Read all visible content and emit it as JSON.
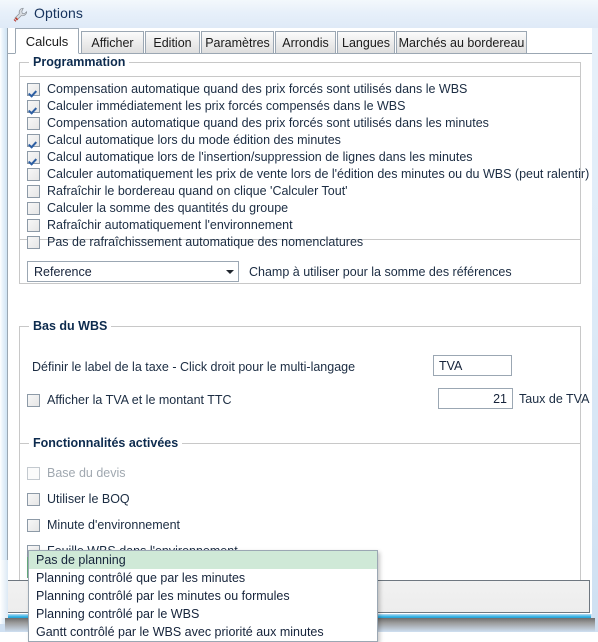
{
  "window": {
    "title": "Options",
    "icon": "wrench-icon"
  },
  "tabs": [
    {
      "label": "Calculs",
      "selected": true
    },
    {
      "label": "Afficher",
      "selected": false
    },
    {
      "label": "Edition",
      "selected": false
    },
    {
      "label": "Paramètres",
      "selected": false
    },
    {
      "label": "Arrondis",
      "selected": false
    },
    {
      "label": "Langues",
      "selected": false
    },
    {
      "label": "Marchés au bordereau",
      "selected": false
    }
  ],
  "groups": {
    "programmation": {
      "title": "Programmation",
      "checkboxes": [
        {
          "label": "Compensation automatique quand des prix forcés sont utilisés dans le WBS",
          "checked": true,
          "disabled": false
        },
        {
          "label": "Calculer immédiatement les prix forcés compensés dans le WBS",
          "checked": true,
          "disabled": false
        },
        {
          "label": "Compensation automatique quand des prix forcés sont utilisés dans les minutes",
          "checked": false,
          "disabled": false
        },
        {
          "label": "Calcul automatique lors du mode édition des minutes",
          "checked": true,
          "disabled": false
        },
        {
          "label": "Calcul automatique lors de l'insertion/suppression de lignes dans les minutes",
          "checked": true,
          "disabled": false
        },
        {
          "label": "Calculer automatiquement les prix de vente lors de l'édition des minutes ou du WBS (peut ralentir)",
          "checked": false,
          "disabled": false
        },
        {
          "label": "Rafraîchir le bordereau quand on clique 'Calculer Tout'",
          "checked": false,
          "disabled": false
        },
        {
          "label": "Calculer la somme des quantités du groupe",
          "checked": false,
          "disabled": false
        },
        {
          "label": "Rafraîchir automatiquement l'environnement",
          "checked": false,
          "disabled": false
        },
        {
          "label": "Pas de rafraîchissement automatique des nomenclatures",
          "checked": false,
          "disabled": false
        }
      ],
      "reference_combo": {
        "value": "Reference"
      },
      "reference_label": "Champ à utiliser pour la somme des références"
    },
    "bas_du_wbs": {
      "title": "Bas du WBS",
      "tax_label_text": "Définir le label de la taxe - Click droit pour le multi-langage",
      "tax_label_value": "TVA",
      "show_tva_checkbox": {
        "label": "Afficher la TVA et le montant TTC",
        "checked": false
      },
      "tva_rate_value": "21",
      "tva_rate_label": "Taux de TVA"
    },
    "fonctionnalites": {
      "title": "Fonctionnalités activées",
      "checkboxes": [
        {
          "label": "Base du devis",
          "checked": false,
          "disabled": true
        },
        {
          "label": "Utiliser le BOQ",
          "checked": false,
          "disabled": false
        },
        {
          "label": "Minute d'environnement",
          "checked": false,
          "disabled": false
        },
        {
          "label": "Feuille WBS dans l'environnement",
          "checked": false,
          "disabled": false
        }
      ],
      "planning_combo": {
        "value": "Pas de planning",
        "open": true,
        "options": [
          {
            "label": "Pas de planning",
            "highlighted": true
          },
          {
            "label": "Planning contrôlé que par les minutes",
            "highlighted": false
          },
          {
            "label": "Planning contrôlé par les minutes ou formules",
            "highlighted": false
          },
          {
            "label": "Planning contrôlé par le WBS",
            "highlighted": false
          },
          {
            "label": "Gantt contrôlé par le WBS avec priorité aux minutes",
            "highlighted": false
          }
        ]
      }
    }
  },
  "colors": {
    "accent_green": "#8cc79e",
    "highlight_green": "#cfe9d7",
    "check_blue": "#2d5fa3",
    "title_text": "#15325c",
    "aero_blue": "#3fb6e6"
  }
}
